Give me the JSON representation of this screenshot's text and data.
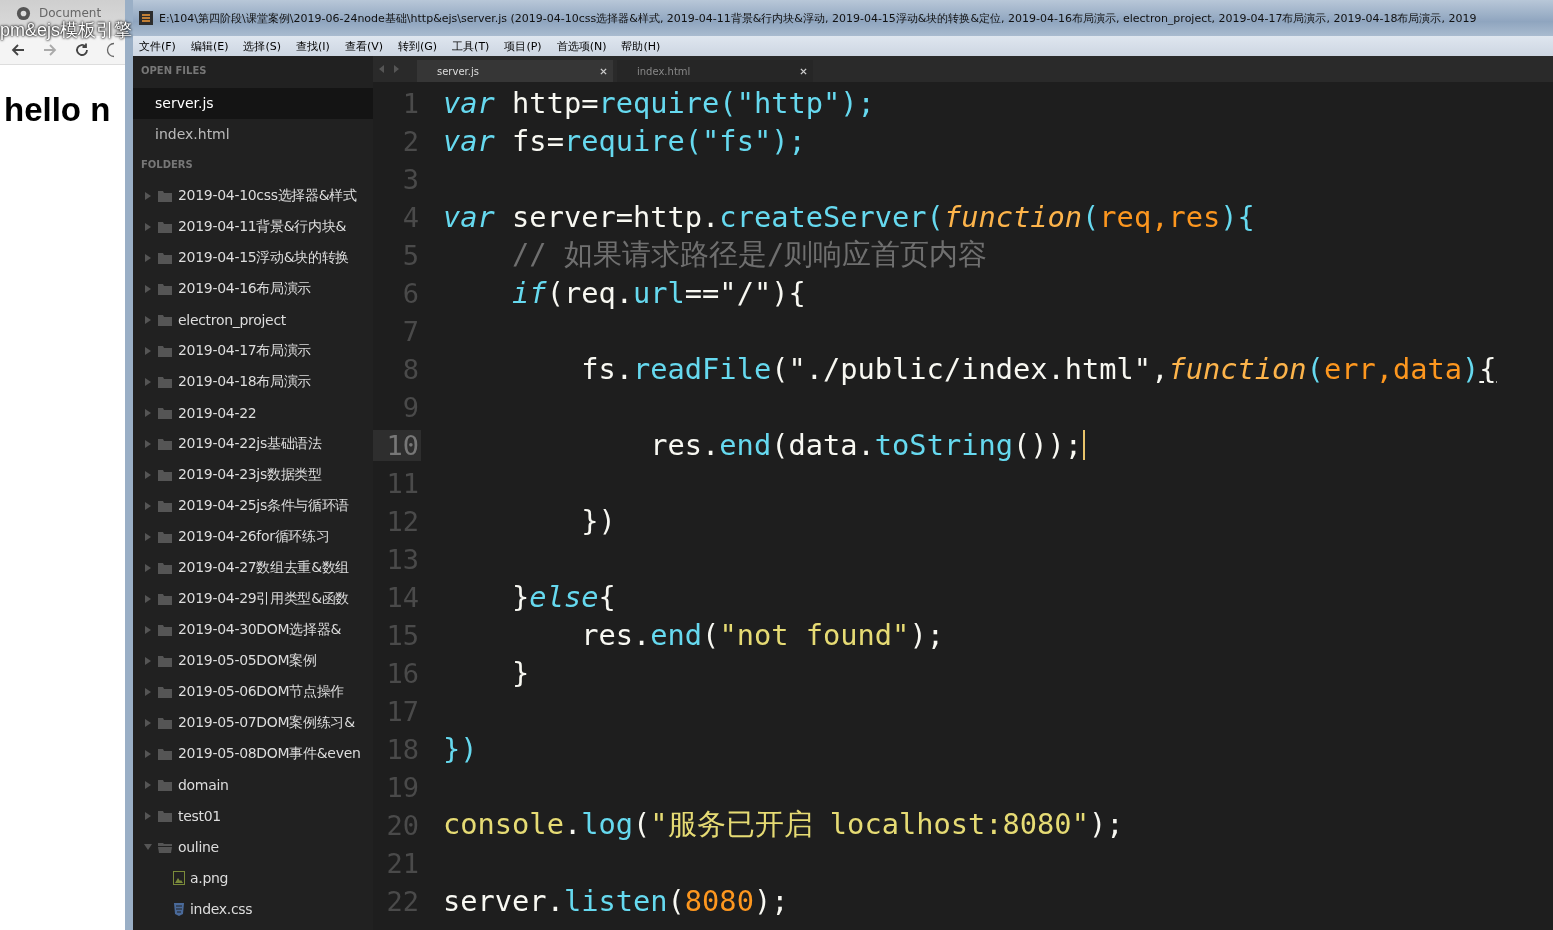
{
  "browser": {
    "tab_title": "Document",
    "window_title": "pm&ejs模板引擎",
    "page_heading": "hello n"
  },
  "window": {
    "title": "E:\\104\\第四阶段\\课堂案例\\2019-06-24node基础\\http&ejs\\server.js (2019-04-10css选择器&样式, 2019-04-11背景&行内块&浮动, 2019-04-15浮动&块的转换&定位, 2019-04-16布局演示, electron_project, 2019-04-17布局演示, 2019-04-18布局演示, 2019"
  },
  "menu": [
    "文件(F)",
    "编辑(E)",
    "选择(S)",
    "查找(I)",
    "查看(V)",
    "转到(G)",
    "工具(T)",
    "项目(P)",
    "首选项(N)",
    "帮助(H)"
  ],
  "sidebar": {
    "open_files_header": "OPEN FILES",
    "open_files": [
      {
        "label": "server.js",
        "selected": true
      },
      {
        "label": "index.html",
        "selected": false
      }
    ],
    "folders_header": "FOLDERS",
    "folders": [
      {
        "label": "2019-04-10css选择器&样式",
        "kind": "folder",
        "expanded": false
      },
      {
        "label": "2019-04-11背景&行内块&",
        "kind": "folder",
        "expanded": false
      },
      {
        "label": "2019-04-15浮动&块的转换",
        "kind": "folder",
        "expanded": false
      },
      {
        "label": "2019-04-16布局演示",
        "kind": "folder",
        "expanded": false
      },
      {
        "label": "electron_project",
        "kind": "folder",
        "expanded": false
      },
      {
        "label": "2019-04-17布局演示",
        "kind": "folder",
        "expanded": false
      },
      {
        "label": "2019-04-18布局演示",
        "kind": "folder",
        "expanded": false
      },
      {
        "label": "2019-04-22",
        "kind": "folder",
        "expanded": false
      },
      {
        "label": "2019-04-22js基础语法",
        "kind": "folder",
        "expanded": false
      },
      {
        "label": "2019-04-23js数据类型",
        "kind": "folder",
        "expanded": false
      },
      {
        "label": "2019-04-25js条件与循环语",
        "kind": "folder",
        "expanded": false
      },
      {
        "label": "2019-04-26for循环练习",
        "kind": "folder",
        "expanded": false
      },
      {
        "label": "2019-04-27数组去重&数组",
        "kind": "folder",
        "expanded": false
      },
      {
        "label": "2019-04-29引用类型&函数",
        "kind": "folder",
        "expanded": false
      },
      {
        "label": "2019-04-30DOM选择器&",
        "kind": "folder",
        "expanded": false
      },
      {
        "label": "2019-05-05DOM案例",
        "kind": "folder",
        "expanded": false
      },
      {
        "label": "2019-05-06DOM节点操作",
        "kind": "folder",
        "expanded": false
      },
      {
        "label": "2019-05-07DOM案例练习&",
        "kind": "folder",
        "expanded": false
      },
      {
        "label": "2019-05-08DOM事件&even",
        "kind": "folder",
        "expanded": false
      },
      {
        "label": "domain",
        "kind": "folder",
        "expanded": false
      },
      {
        "label": "test01",
        "kind": "folder",
        "expanded": false
      },
      {
        "label": "ouline",
        "kind": "folder",
        "expanded": true,
        "children": [
          {
            "label": "a.png",
            "kind": "image"
          },
          {
            "label": "index.css",
            "kind": "css"
          }
        ]
      }
    ]
  },
  "tabs": [
    {
      "label": "server.js",
      "selected": true
    },
    {
      "label": "index.html",
      "selected": false
    }
  ],
  "code": [
    {
      "number": "1",
      "current": false,
      "tokens": [
        {
          "text": "var",
          "kind": "kw"
        },
        {
          "text": " http=",
          "kind": "pl"
        },
        {
          "text": "require(\"http\");",
          "kind": "fn"
        }
      ]
    },
    {
      "number": "2",
      "current": false,
      "tokens": [
        {
          "text": "var",
          "kind": "kw"
        },
        {
          "text": " fs=",
          "kind": "pl"
        },
        {
          "text": "require(\"fs\");",
          "kind": "fn"
        }
      ]
    },
    {
      "number": "3",
      "current": false
    },
    {
      "number": "4",
      "current": false,
      "tokens": [
        {
          "text": "var",
          "kind": "kw"
        },
        {
          "text": " server=http.",
          "kind": "pl"
        },
        {
          "text": "createServer(",
          "kind": "fn"
        },
        {
          "text": "function",
          "kind": "fk"
        },
        {
          "text": "(",
          "kind": "fn"
        },
        {
          "text": "req,res",
          "kind": "par"
        },
        {
          "text": "){",
          "kind": "fn"
        }
      ]
    },
    {
      "number": "5",
      "current": false,
      "tokens": [
        {
          "text": "    // 如果请求路径是/则响应首页内容",
          "kind": "cm"
        }
      ]
    },
    {
      "number": "6",
      "current": false,
      "tokens": [
        {
          "text": "    if",
          "kind": "kw"
        },
        {
          "text": "(req.",
          "kind": "pl"
        },
        {
          "text": "url",
          "kind": "fn"
        },
        {
          "text": "==\"/\"){",
          "kind": "pl"
        }
      ]
    },
    {
      "number": "7",
      "current": false
    },
    {
      "number": "8",
      "current": false,
      "tokens": [
        {
          "text": "        fs.",
          "kind": "pl"
        },
        {
          "text": "readFile",
          "kind": "fn"
        },
        {
          "text": "(\"./public/index.html\",",
          "kind": "pl"
        },
        {
          "text": "function",
          "kind": "fk"
        },
        {
          "text": "(",
          "kind": "fn"
        },
        {
          "text": "err,data",
          "kind": "par"
        },
        {
          "text": ")",
          "kind": "fn"
        },
        {
          "text": "{",
          "kind": "match"
        }
      ]
    },
    {
      "number": "9",
      "current": false
    },
    {
      "number": "10",
      "current": true,
      "tokens": [
        {
          "text": "            res.",
          "kind": "pl"
        },
        {
          "text": "end",
          "kind": "fn"
        },
        {
          "text": "(data.",
          "kind": "pl"
        },
        {
          "text": "toString",
          "kind": "fn"
        },
        {
          "text": "());",
          "kind": "pl"
        }
      ]
    },
    {
      "number": "11",
      "current": false
    },
    {
      "number": "12",
      "current": false,
      "tokens": [
        {
          "text": "        })",
          "kind": "pl"
        }
      ]
    },
    {
      "number": "13",
      "current": false
    },
    {
      "number": "14",
      "current": false,
      "tokens": [
        {
          "text": "    }",
          "kind": "pl"
        },
        {
          "text": "else",
          "kind": "kw"
        },
        {
          "text": "{",
          "kind": "pl"
        }
      ]
    },
    {
      "number": "15",
      "current": false,
      "tokens": [
        {
          "text": "        res.",
          "kind": "pl"
        },
        {
          "text": "end",
          "kind": "fn"
        },
        {
          "text": "(",
          "kind": "pl"
        },
        {
          "text": "\"not found\"",
          "kind": "str"
        },
        {
          "text": ");",
          "kind": "pl"
        }
      ]
    },
    {
      "number": "16",
      "current": false,
      "tokens": [
        {
          "text": "    }",
          "kind": "pl"
        }
      ]
    },
    {
      "number": "17",
      "current": false
    },
    {
      "number": "18",
      "current": false,
      "tokens": [
        {
          "text": "})",
          "kind": "fn"
        }
      ]
    },
    {
      "number": "19",
      "current": false
    },
    {
      "number": "20",
      "current": false,
      "tokens": [
        {
          "text": "console",
          "kind": "obj"
        },
        {
          "text": ".",
          "kind": "pl"
        },
        {
          "text": "log",
          "kind": "fn"
        },
        {
          "text": "(",
          "kind": "pl"
        },
        {
          "text": "\"服务已开启 localhost:8080\"",
          "kind": "str"
        },
        {
          "text": ");",
          "kind": "pl"
        }
      ]
    },
    {
      "number": "21",
      "current": false
    },
    {
      "number": "22",
      "current": false,
      "tokens": [
        {
          "text": "server.",
          "kind": "pl"
        },
        {
          "text": "listen",
          "kind": "fn"
        },
        {
          "text": "(",
          "kind": "pl"
        },
        {
          "text": "8080",
          "kind": "num"
        },
        {
          "text": ");",
          "kind": "pl"
        }
      ]
    }
  ]
}
